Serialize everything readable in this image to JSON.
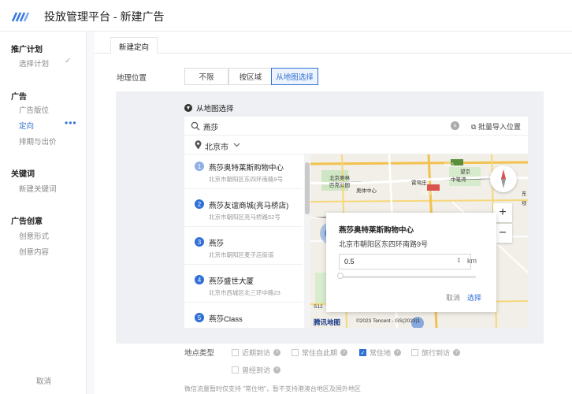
{
  "app": {
    "title": "投放管理平台 - 新建广告"
  },
  "sidebar": {
    "sections": [
      {
        "title": "推广计划",
        "items": [
          {
            "label": "选择计划",
            "done": true
          }
        ]
      },
      {
        "title": "广告",
        "items": [
          {
            "label": "广告版位"
          },
          {
            "label": "定向",
            "active": true
          },
          {
            "label": "排期与出价"
          }
        ]
      },
      {
        "title": "关键词",
        "items": [
          {
            "label": "新建关键词"
          }
        ]
      },
      {
        "title": "广告创意",
        "items": [
          {
            "label": "创意形式"
          },
          {
            "label": "创意内容"
          }
        ]
      }
    ],
    "cancel": "取消"
  },
  "tabs": [
    {
      "label": "新建定向"
    }
  ],
  "geo": {
    "label": "地理位置",
    "options": [
      "不限",
      "按区域",
      "从地图选择"
    ],
    "selected": "从地图选择"
  },
  "map_select": {
    "toggle_label": "从地图选择",
    "search_value": "燕莎",
    "batch_import": "批量导入位置",
    "city": "北京市",
    "results": [
      {
        "no": "1",
        "name": "燕莎奥特莱斯购物中心",
        "addr": "北京市朝阳区东四环南路9号"
      },
      {
        "no": "2",
        "name": "燕莎友谊商城(亮马桥店)",
        "addr": "北京市朝阳区亮马桥路52号"
      },
      {
        "no": "3",
        "name": "燕莎",
        "addr": "北京市朝阳区麦子店街道"
      },
      {
        "no": "4",
        "name": "燕莎盛世大厦",
        "addr": "北京市西城区北三环中路23"
      },
      {
        "no": "5",
        "name": "燕莎Class",
        "addr": ""
      }
    ],
    "popup": {
      "title": "燕莎奥特莱斯购物中心",
      "addr": "北京市朝阳区东四环南路9号",
      "radius": "0.5",
      "unit": "km",
      "cancel": "取消",
      "select": "选择"
    },
    "map_labels": {
      "l1": "北京奥林",
      "l2": "匹克公园",
      "l3": "S50",
      "l4": "奥体中心",
      "l5": "望京",
      "l6": "霄驾庄",
      "l7": "G101",
      "l8": "中笔湾",
      "l9": "东",
      "l10": "坝",
      "l11": "S12"
    },
    "map_logo": "腾讯地图",
    "map_copyright": "©2023 Tencent - GS(2023)1"
  },
  "location_type": {
    "label": "地点类型",
    "options": [
      {
        "label": "近期到访",
        "checked": false
      },
      {
        "label": "常住自此期",
        "checked": false
      },
      {
        "label": "常住地",
        "checked": true
      },
      {
        "label": "旅行到访",
        "checked": false
      },
      {
        "label": "曾经到访",
        "checked": false
      }
    ]
  },
  "note": "微信流量暂时仅支持 \"常住地\"，暂不支持港澳台地区及国外地区",
  "colors": {
    "accent": "#2f6fd6",
    "panel_bg": "#eef0f3"
  }
}
